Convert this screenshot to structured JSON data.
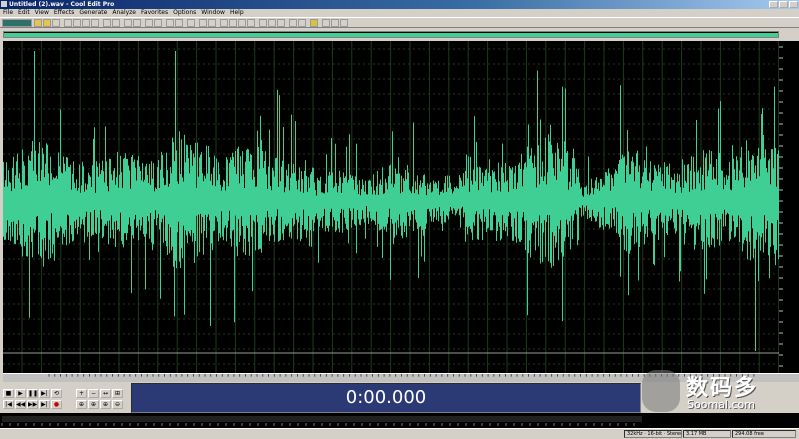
{
  "window": {
    "title": "Untitled (2).wav - Cool Edit Pro"
  },
  "menu": [
    "File",
    "Edit",
    "View",
    "Effects",
    "Generate",
    "Analyze",
    "Favorites",
    "Options",
    "Window",
    "Help"
  ],
  "display": {
    "time": "0:00.000"
  },
  "status": {
    "format": "32kHz · 16-bit · Stereo",
    "size": "3.17 MB",
    "free": "294.08 free"
  },
  "watermark": {
    "chinese": "数码多",
    "domain": "Soomal.com"
  },
  "colors": {
    "waveform": "#3fcf94",
    "background": "#000000",
    "grid": "#1f3a1f",
    "time_display": "#2b3a74"
  }
}
